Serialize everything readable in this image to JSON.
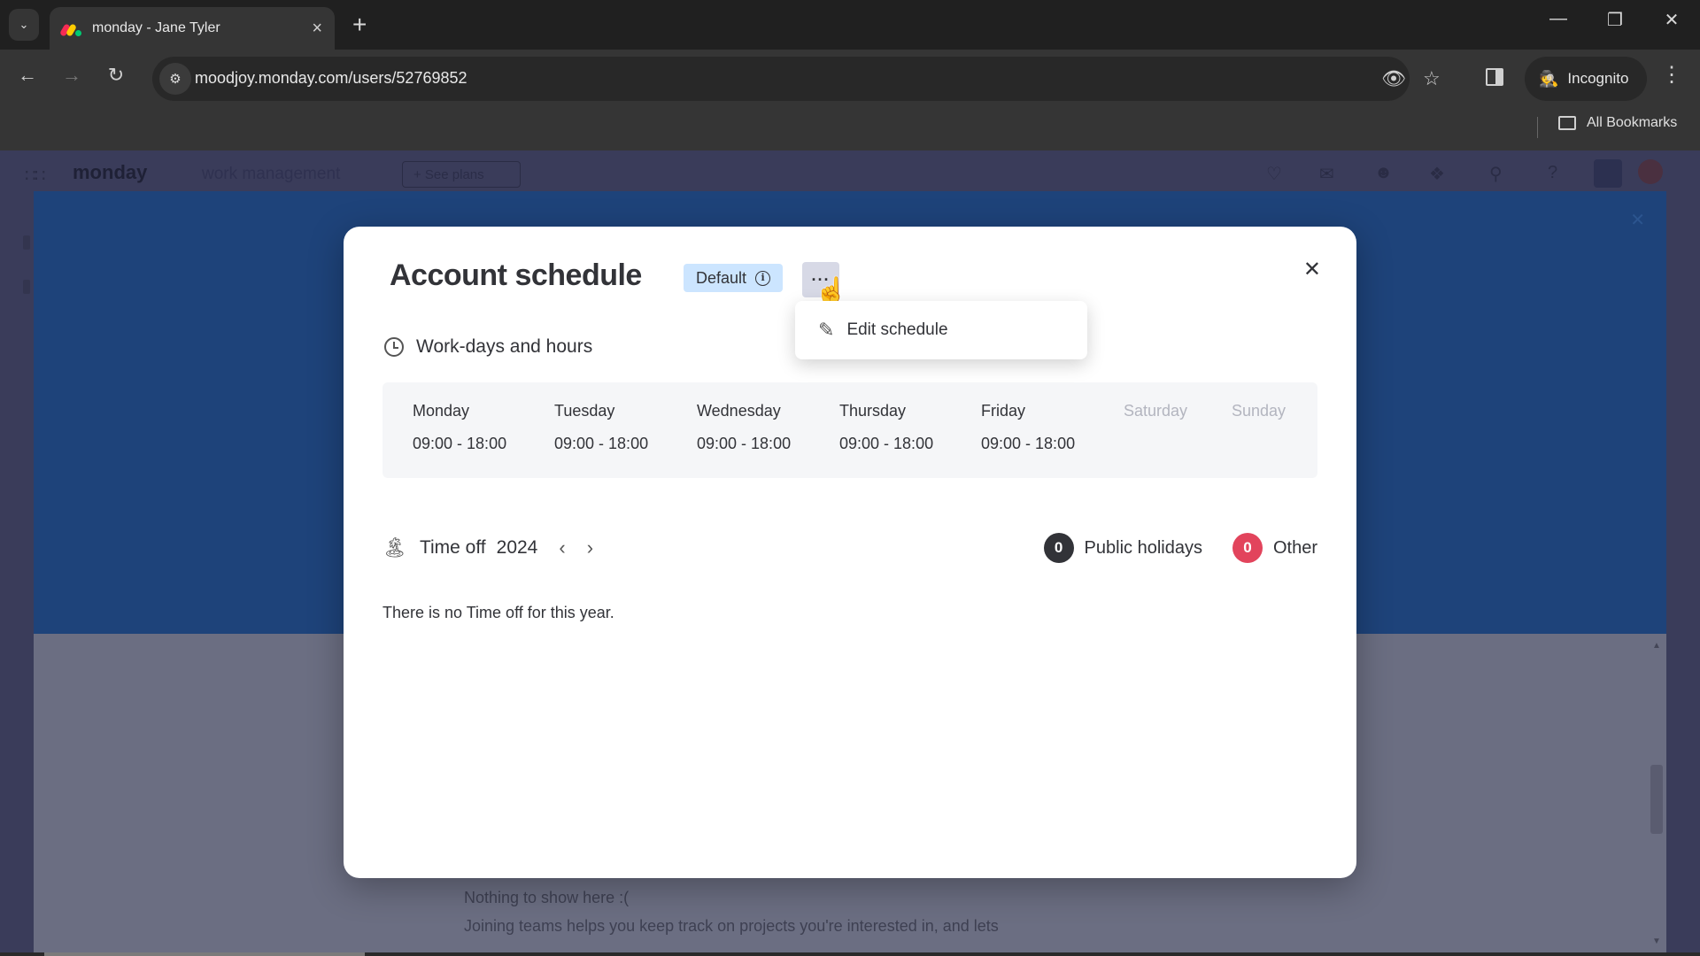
{
  "browser": {
    "tab_title": "monday - Jane Tyler",
    "url": "moodjoy.monday.com/users/52769852",
    "incognito_label": "Incognito",
    "all_bookmarks_label": "All Bookmarks"
  },
  "app_header": {
    "logo": "monday",
    "logo_sub": "work management",
    "see_plans": "+ See plans"
  },
  "background_content": {
    "empty_title": "Nothing to show here :(",
    "empty_body": "Joining teams helps you keep track on projects you're interested in, and lets"
  },
  "modal": {
    "title": "Account schedule",
    "badge": "Default",
    "more_button": "···",
    "menu": {
      "items": [
        {
          "label": "Edit schedule",
          "icon": "pencil-icon"
        }
      ]
    },
    "workdays": {
      "heading": "Work-days and hours",
      "days": [
        {
          "name": "Monday",
          "hours": "09:00 - 18:00",
          "active": true
        },
        {
          "name": "Tuesday",
          "hours": "09:00 - 18:00",
          "active": true
        },
        {
          "name": "Wednesday",
          "hours": "09:00 - 18:00",
          "active": true
        },
        {
          "name": "Thursday",
          "hours": "09:00 - 18:00",
          "active": true
        },
        {
          "name": "Friday",
          "hours": "09:00 - 18:00",
          "active": true
        },
        {
          "name": "Saturday",
          "hours": "",
          "active": false
        },
        {
          "name": "Sunday",
          "hours": "",
          "active": false
        }
      ]
    },
    "time_off": {
      "heading": "Time off",
      "year": "2024",
      "legend": [
        {
          "count": "0",
          "label": "Public holidays",
          "color": "#323338"
        },
        {
          "count": "0",
          "label": "Other",
          "color": "#e2445c"
        }
      ],
      "empty_message": "There is no Time off for this year."
    }
  },
  "colors": {
    "badge_bg": "#cce5ff",
    "banner": "#1e437a",
    "other_red": "#e2445c"
  }
}
